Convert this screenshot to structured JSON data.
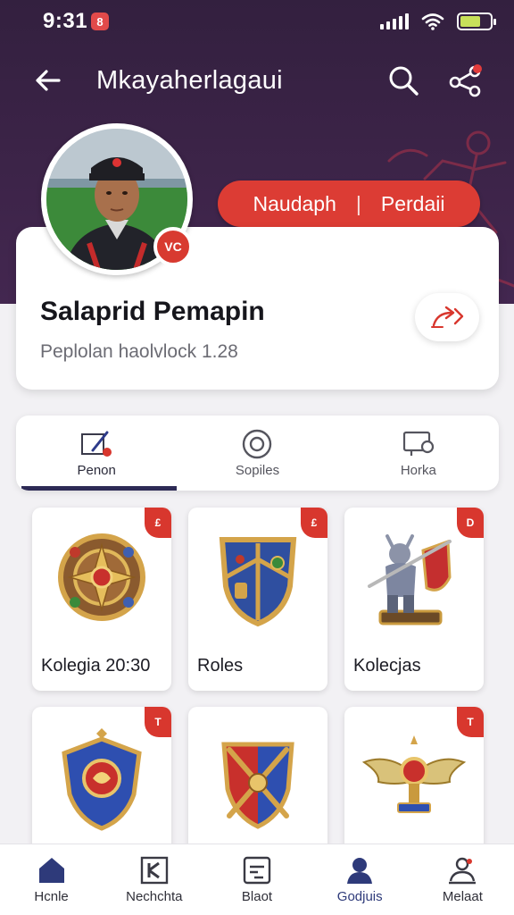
{
  "status_bar": {
    "time": "9:31",
    "badge_icon": "app-notification-icon",
    "icons": [
      "signal-icon",
      "wifi-icon",
      "battery-icon"
    ]
  },
  "topbar": {
    "title": "Mkayaherlagaui",
    "back_icon": "arrow-left-icon",
    "search_icon": "search-icon",
    "share_icon": "share-icon"
  },
  "profile": {
    "avatar_badge": "VC",
    "action_pill": {
      "left": "Naudaph",
      "separator": "|",
      "right": "Perdaii"
    },
    "name": "Salaprid Pemapin",
    "subtitle": "Peplolan haolvlock 1.28",
    "action_icon": "share-arrow-icon"
  },
  "tabs": [
    {
      "label": "Penon",
      "icon": "edit-icon",
      "active": true
    },
    {
      "label": "Sopiles",
      "icon": "target-icon",
      "active": false
    },
    {
      "label": "Horka",
      "icon": "camera-icon",
      "active": false
    }
  ],
  "items": [
    {
      "label": "Kolegia 20:30",
      "corner": "£",
      "icon": "round-shield-icon"
    },
    {
      "label": "Roles",
      "corner": "£",
      "icon": "crest-shield-icon"
    },
    {
      "label": "Kolecjas",
      "corner": "D",
      "icon": "warrior-figure-icon"
    },
    {
      "label": "",
      "corner": "T",
      "icon": "blue-shield-icon"
    },
    {
      "label": "",
      "corner": "T",
      "icon": "cross-shield-icon"
    },
    {
      "label": "",
      "corner": "T",
      "icon": "winged-trophy-icon"
    }
  ],
  "bottom_nav": [
    {
      "label": "Hcnle",
      "icon": "home-icon",
      "active": false
    },
    {
      "label": "Nechchta",
      "icon": "book-icon",
      "active": false
    },
    {
      "label": "Blaot",
      "icon": "chart-icon",
      "active": false
    },
    {
      "label": "Godjuis",
      "icon": "person-icon",
      "active": true
    },
    {
      "label": "Melaat",
      "icon": "profile-settings-icon",
      "active": false
    }
  ],
  "colors": {
    "hero": "#3d2449",
    "accent_red": "#dc3c34",
    "tab_indicator": "#2d2a55",
    "nav_active": "#2e3a7a"
  }
}
